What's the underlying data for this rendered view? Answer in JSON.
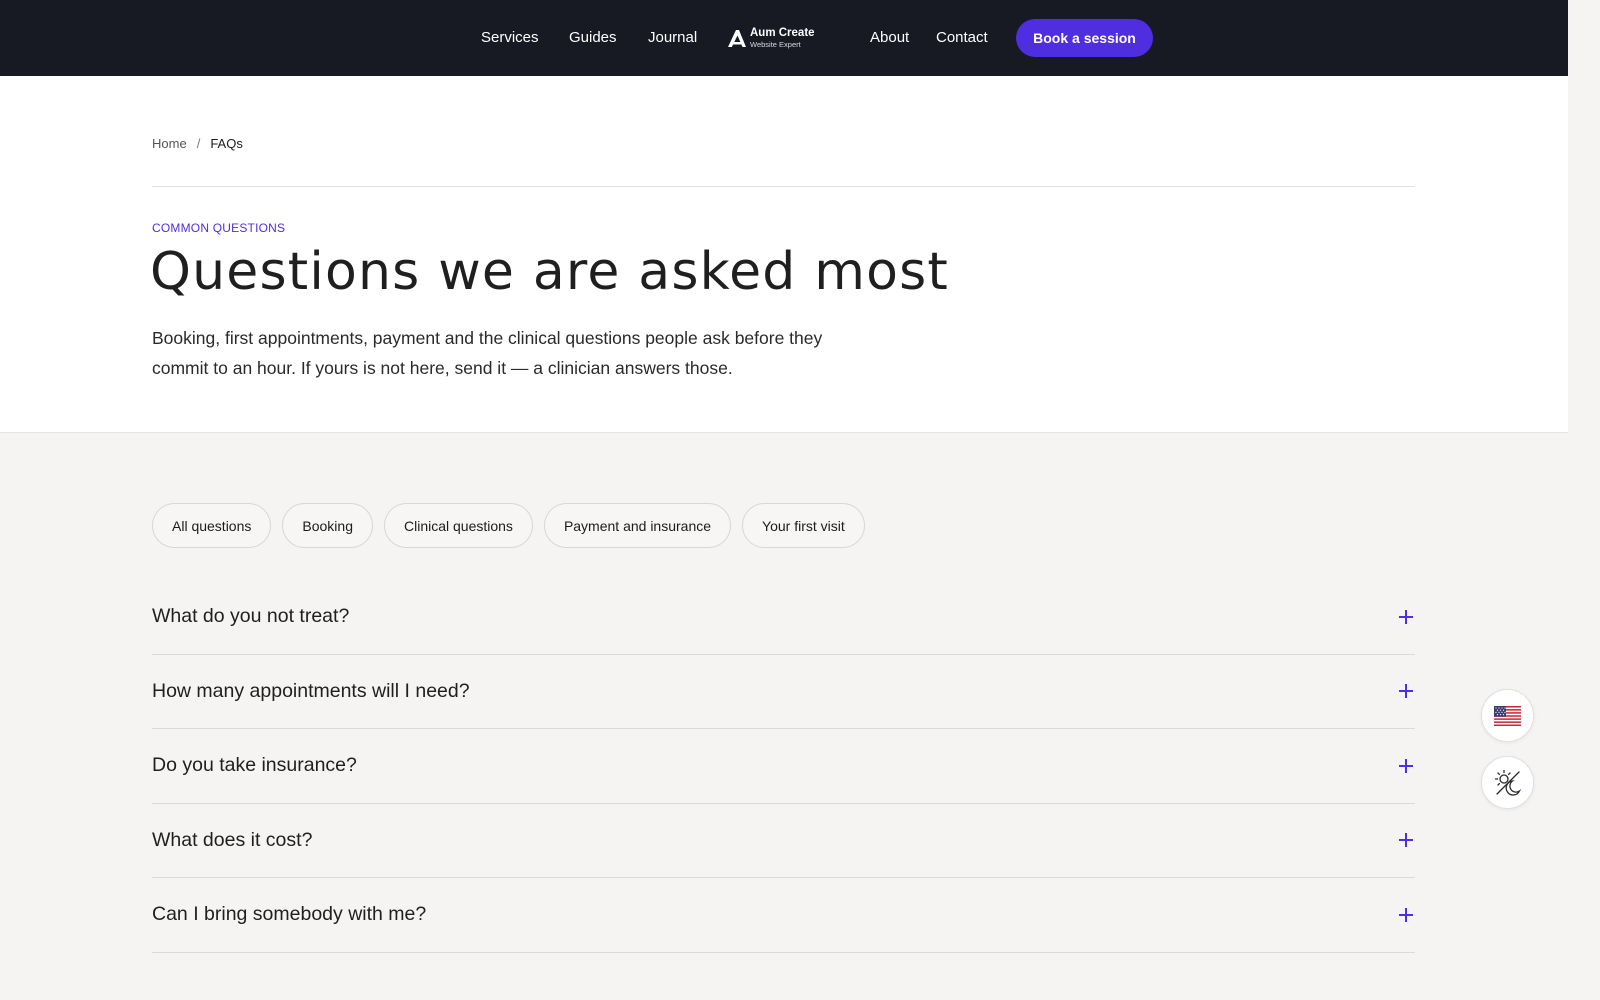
{
  "nav": {
    "links": [
      "Services",
      "Guides",
      "Journal",
      "About",
      "Contact"
    ],
    "logo": {
      "name": "Aum Create",
      "tagline": "Website Expert"
    },
    "cta": "Book a session"
  },
  "breadcrumb": {
    "home": "Home",
    "separator": "/",
    "current": "FAQs"
  },
  "hero": {
    "eyebrow": "COMMON QUESTIONS",
    "title": "Questions we are asked most",
    "intro": "Booking, first appointments, payment and the clinical questions people ask before they commit to an hour. If yours is not here, send it — a clinician answers those."
  },
  "filters": [
    "All questions",
    "Booking",
    "Clinical questions",
    "Payment and insurance",
    "Your first visit"
  ],
  "faqs": [
    "What do you not treat?",
    "How many appointments will I need?",
    "Do you take insurance?",
    "What does it cost?",
    "Can I bring somebody with me?"
  ],
  "colors": {
    "accent": "#4f2ee0",
    "header_bg": "#171923",
    "page_bg": "#f5f4f2"
  },
  "icons": {
    "language": "us-flag-icon",
    "theme": "theme-toggle-icon",
    "expand": "plus-icon"
  }
}
